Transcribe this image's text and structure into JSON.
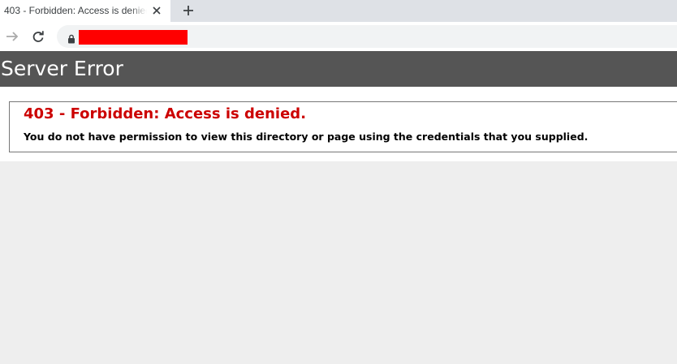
{
  "browser": {
    "tab": {
      "title": "403 - Forbidden: Access is denied."
    },
    "address_bar": {
      "url": ""
    }
  },
  "page": {
    "header": {
      "title": "Server Error"
    },
    "error": {
      "title": "403 - Forbidden: Access is denied.",
      "message": "You do not have permission to view this directory or page using the credentials that you supplied."
    }
  },
  "colors": {
    "header_bg": "#555555",
    "error_title": "#cc0000",
    "url_redaction": "#ff0000"
  }
}
